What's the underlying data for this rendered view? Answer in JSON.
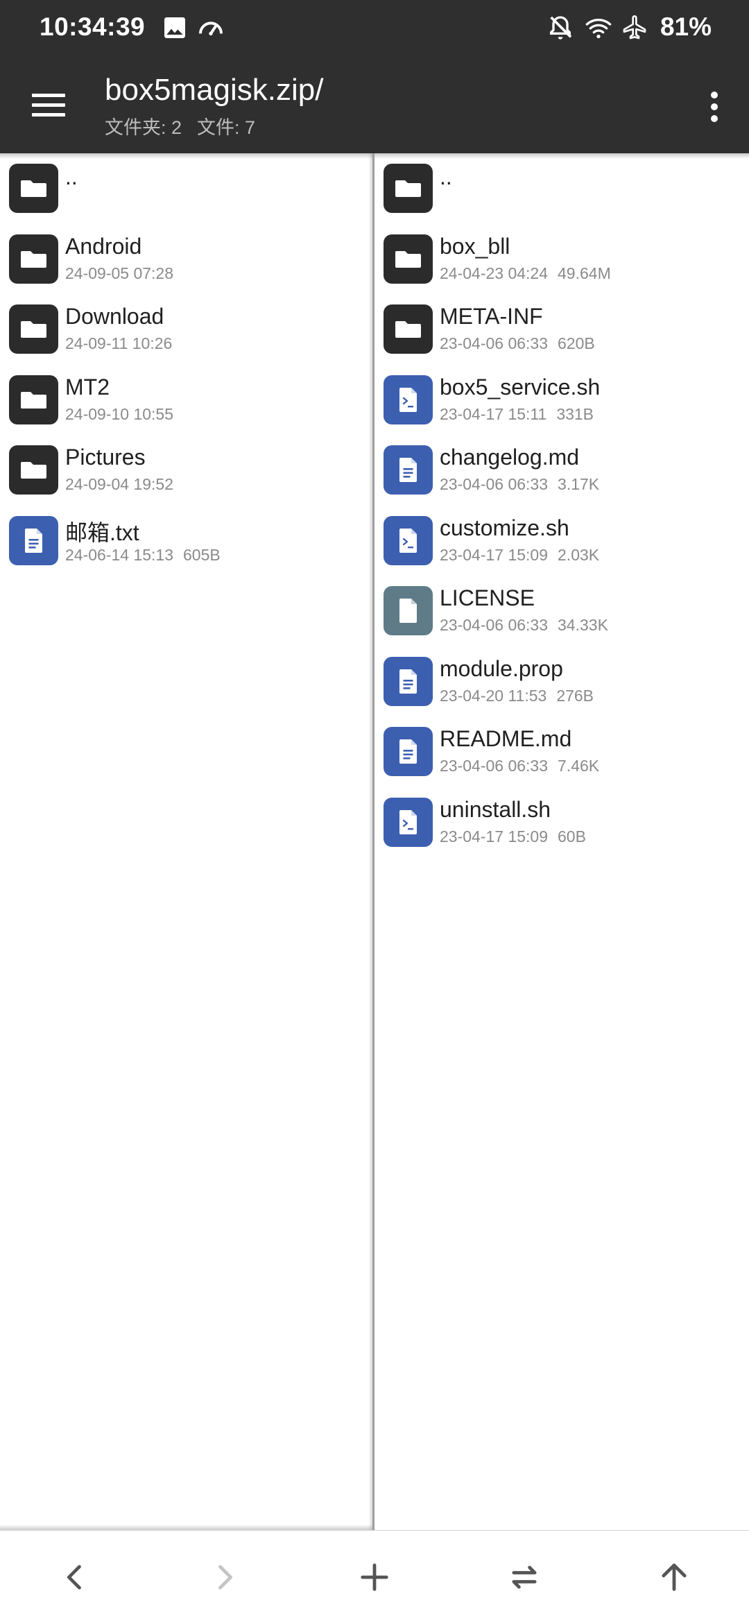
{
  "status_bar": {
    "time": "10:34:39",
    "battery": "81%",
    "left_icons": [
      "image-icon",
      "speedometer-icon"
    ],
    "right_icons": [
      "notifications-off-icon",
      "wifi-icon",
      "airplane-mode-icon"
    ]
  },
  "toolbar": {
    "title": "box5magisk.zip/",
    "folder_count": "文件夹: 2",
    "file_count": "文件: 7"
  },
  "left_pane": {
    "items": [
      {
        "name": "..",
        "date": "",
        "size": "",
        "type": "folder"
      },
      {
        "name": "Android",
        "date": "24-09-05 07:28",
        "size": "",
        "type": "folder"
      },
      {
        "name": "Download",
        "date": "24-09-11 10:26",
        "size": "",
        "type": "folder"
      },
      {
        "name": "MT2",
        "date": "24-09-10 10:55",
        "size": "",
        "type": "folder"
      },
      {
        "name": "Pictures",
        "date": "24-09-04 19:52",
        "size": "",
        "type": "folder"
      },
      {
        "name": "邮箱.txt",
        "date": "24-06-14 15:13",
        "size": "605B",
        "type": "text"
      }
    ]
  },
  "right_pane": {
    "items": [
      {
        "name": "..",
        "date": "",
        "size": "",
        "type": "folder"
      },
      {
        "name": "box_bll",
        "date": "24-04-23 04:24",
        "size": "49.64M",
        "type": "folder"
      },
      {
        "name": "META-INF",
        "date": "23-04-06 06:33",
        "size": "620B",
        "type": "folder"
      },
      {
        "name": "box5_service.sh",
        "date": "23-04-17 15:11",
        "size": "331B",
        "type": "script"
      },
      {
        "name": "changelog.md",
        "date": "23-04-06 06:33",
        "size": "3.17K",
        "type": "text"
      },
      {
        "name": "customize.sh",
        "date": "23-04-17 15:09",
        "size": "2.03K",
        "type": "script"
      },
      {
        "name": "LICENSE",
        "date": "23-04-06 06:33",
        "size": "34.33K",
        "type": "generic"
      },
      {
        "name": "module.prop",
        "date": "23-04-20 11:53",
        "size": "276B",
        "type": "text"
      },
      {
        "name": "README.md",
        "date": "23-04-06 06:33",
        "size": "7.46K",
        "type": "text"
      },
      {
        "name": "uninstall.sh",
        "date": "23-04-17 15:09",
        "size": "60B",
        "type": "script"
      }
    ]
  },
  "bottom_nav": {
    "buttons": [
      "back-icon",
      "forward-icon",
      "add-icon",
      "swap-panes-icon",
      "go-up-icon"
    ]
  },
  "colors": {
    "bar_background": "#2f2f2f",
    "folder_icon": "#2b2b2b",
    "text_file_icon": "#3c5fb0",
    "generic_file_icon": "#5f7b88"
  }
}
